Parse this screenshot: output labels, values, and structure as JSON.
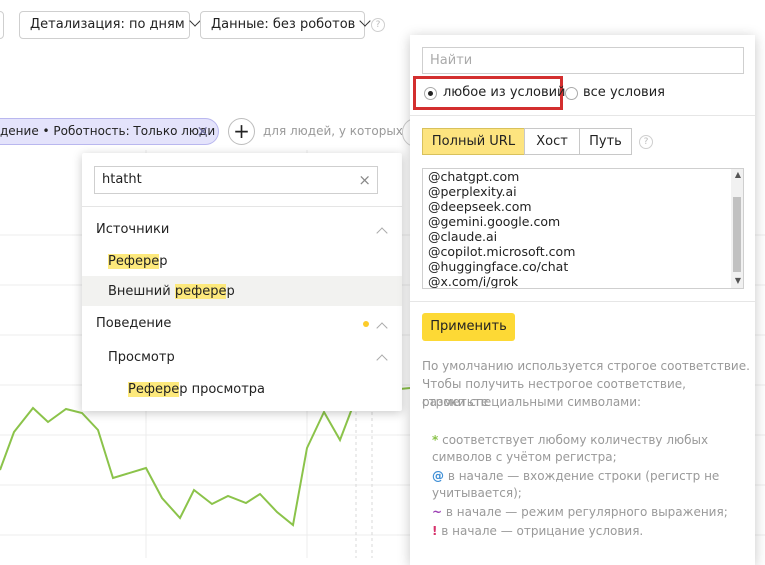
{
  "toolbar": {
    "detail_label": "Детализация: по дням",
    "data_label": "Данные: без роботов",
    "help": "?"
  },
  "segment": {
    "chip_text": "дение • Роботность: Только люди",
    "chip_close": "×",
    "add_symbol": "+",
    "people_label": "для людей, у которых"
  },
  "dropdown": {
    "search_value": "htatht",
    "clear_symbol": "×",
    "groups": [
      {
        "label": "Источники",
        "items": [
          {
            "highlight": "Рефере",
            "rest": "р",
            "prefix": ""
          },
          {
            "prefix": "Внешний ",
            "highlight": "рефере",
            "rest": "р"
          }
        ]
      },
      {
        "label": "Поведение",
        "subgroup": "Просмотр",
        "items": [
          {
            "prefix": "",
            "highlight": "Рефере",
            "rest": "р просмотра"
          }
        ]
      }
    ]
  },
  "panel": {
    "find_placeholder": "Найти",
    "match_any": "любое из условий",
    "match_all": "все условия",
    "modes": [
      "Полный URL",
      "Хост",
      "Путь"
    ],
    "help": "?",
    "urls": [
      "@chatgpt.com",
      "@perplexity.ai",
      "@deepseek.com",
      "@gemini.google.com",
      "@claude.ai",
      "@copilot.microsoft.com",
      "@huggingface.co/chat",
      "@x.com/i/grok"
    ],
    "apply_label": "Применить",
    "note_line1": "По умолчанию используется строгое соответствие.",
    "note_line2": "Чтобы получить нестрогое соответствие, разметьте",
    "note_line3": "строки специальными символами:",
    "rule_star_sym": "*",
    "rule_star_l1": " соответствует любому количеству любых",
    "rule_star_l2": "символов с учётом регистра;",
    "rule_at_sym": "@",
    "rule_at_l1": " в начале — вхождение строки (регистр не",
    "rule_at_l2": "учитывается);",
    "rule_tilde_sym": "~",
    "rule_tilde_l1": " в начале — режим регулярного выражения;",
    "rule_excl_sym": "!",
    "rule_excl_l1": " в начале — отрицание условия."
  },
  "colors": {
    "chart_line": "#8bc34a",
    "chip_bg": "#e4e3fb",
    "highlight": "#fde97c",
    "apply": "#fdd935",
    "active_mode": "#fde47f",
    "red_outline": "#d32f2f",
    "rule_star": "#8bc34a",
    "rule_at": "#3f8fd6",
    "rule_tilde": "#9c3fb4",
    "rule_excl": "#d6336c"
  }
}
